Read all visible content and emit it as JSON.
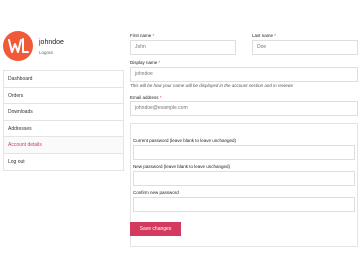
{
  "profile": {
    "avatar_initials": "WL",
    "username": "johndoe",
    "logout_link": "Logout"
  },
  "nav": {
    "items": [
      {
        "label": "Dashboard"
      },
      {
        "label": "Orders"
      },
      {
        "label": "Downloads"
      },
      {
        "label": "Addresses"
      },
      {
        "label": "Account details"
      },
      {
        "label": "Log out"
      }
    ],
    "active": "Account details"
  },
  "form": {
    "first_name_label": "First name",
    "first_name_value": "John",
    "last_name_label": "Last name",
    "last_name_value": "Doe",
    "required_marker": "*",
    "display_name_label": "Display name",
    "display_name_value": "johndoe",
    "display_name_help": "This will be how your name will be displayed in the account section and in reviews",
    "email_label": "Email address",
    "email_value": "johndoe@example.com",
    "current_password_label": "Current password (leave blank to leave unchanged)",
    "new_password_label": "New password (leave blank to leave unchanged)",
    "confirm_password_label": "Confirm new password",
    "save_label": "Save changes"
  },
  "colors": {
    "accent": "#d33a5e",
    "avatar_bg": "#f15a38",
    "required": "#e23d3d"
  }
}
